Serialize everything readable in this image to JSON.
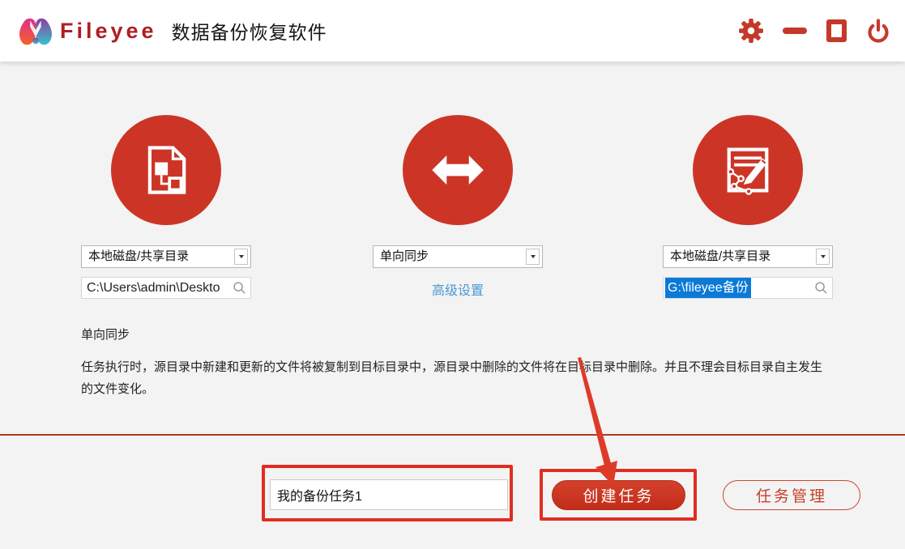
{
  "header": {
    "brand": "Fileyee",
    "app_title": "数据备份恢复软件"
  },
  "source": {
    "type": "本地磁盘/共享目录",
    "path": "C:\\Users\\admin\\Deskto"
  },
  "sync": {
    "mode": "单向同步",
    "advanced_link": "高级设置"
  },
  "target": {
    "type": "本地磁盘/共享目录",
    "path": "G:\\fileyee备份"
  },
  "info": {
    "heading": "单向同步",
    "body": "任务执行时，源目录中新建和更新的文件将被复制到目标目录中，源目录中删除的文件将在目标目录中删除。并且不理会目标目录自主发生的文件变化。"
  },
  "actions": {
    "task_name": "我的备份任务1",
    "create_label": "创建任务",
    "manage_label": "任务管理"
  },
  "colors": {
    "accent_red": "#cc3526",
    "brand_red": "#ad1f23",
    "link_blue": "#4a9ad4",
    "selection_blue": "#0b7ad7",
    "annotation_red": "#e02d22",
    "divider_red": "#a93a20"
  }
}
